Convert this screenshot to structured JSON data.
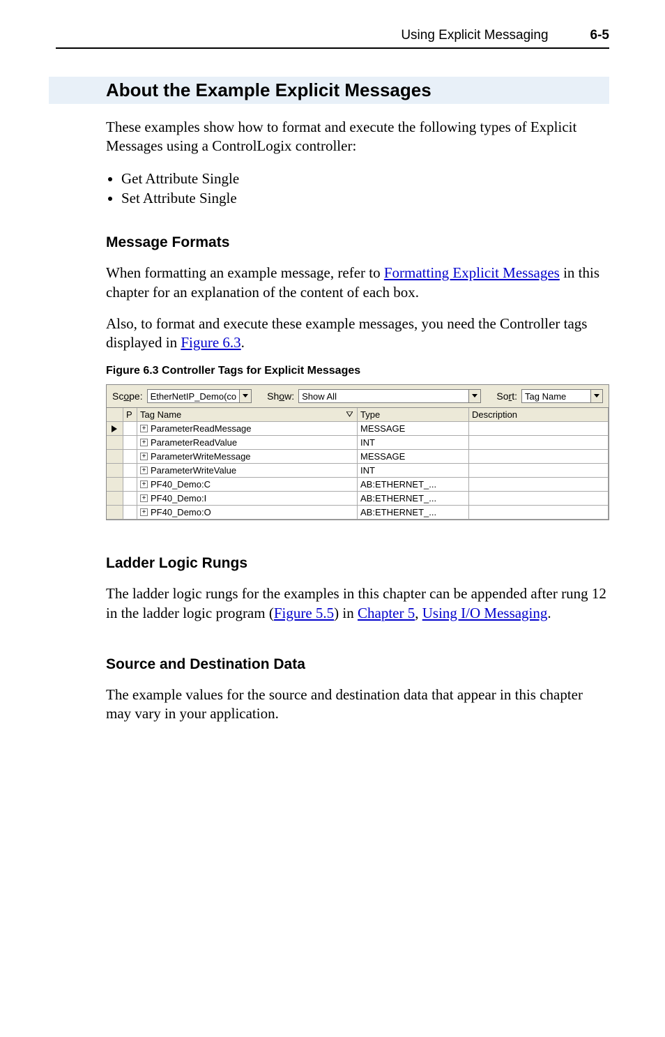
{
  "header": {
    "title": "Using Explicit Messaging",
    "page_number": "6-5"
  },
  "section": {
    "heading": "About the Example Explicit Messages",
    "intro": "These examples show how to format and execute the following types of Explicit Messages using a ControlLogix controller:",
    "bullets": [
      "Get Attribute Single",
      "Set Attribute Single"
    ]
  },
  "message_formats": {
    "heading": "Message Formats",
    "para1_before": "When formatting an example message, refer to ",
    "para1_link": "Formatting Explicit Messages",
    "para1_after": " in this chapter for an explanation of the content of each box.",
    "para2_before": "Also, to format and execute these example messages, you need the Controller tags displayed in ",
    "para2_link": "Figure 6.3",
    "para2_after": "."
  },
  "figure": {
    "caption": "Figure 6.3   Controller Tags for Explicit Messages",
    "topbar": {
      "scope_label": "Scope:",
      "scope_value": "EtherNetIP_Demo(co",
      "show_label": "Show:",
      "show_value": "Show All",
      "sort_label": "Sort:",
      "sort_value": "Tag Name"
    },
    "columns": {
      "p": "P",
      "tag": "Tag Name",
      "type": "Type",
      "desc": "Description"
    },
    "rows": [
      {
        "tag": "ParameterReadMessage",
        "type": "MESSAGE"
      },
      {
        "tag": "ParameterReadValue",
        "type": "INT"
      },
      {
        "tag": "ParameterWriteMessage",
        "type": "MESSAGE"
      },
      {
        "tag": "ParameterWriteValue",
        "type": "INT"
      },
      {
        "tag": "PF40_Demo:C",
        "type": "AB:ETHERNET_..."
      },
      {
        "tag": "PF40_Demo:I",
        "type": "AB:ETHERNET_..."
      },
      {
        "tag": "PF40_Demo:O",
        "type": "AB:ETHERNET_..."
      }
    ]
  },
  "ladder": {
    "heading": "Ladder Logic Rungs",
    "before1": "The ladder logic rungs for the examples in this chapter can be appended after rung 12 in the ladder logic program (",
    "link1": "Figure 5.5",
    "mid": ") in ",
    "link2": "Chapter 5",
    "after2": ", ",
    "link3": "Using I/O Messaging",
    "end": "."
  },
  "source_dest": {
    "heading": "Source and Destination Data",
    "para": "The example values for the source and destination data that appear in this chapter may vary in your application."
  }
}
